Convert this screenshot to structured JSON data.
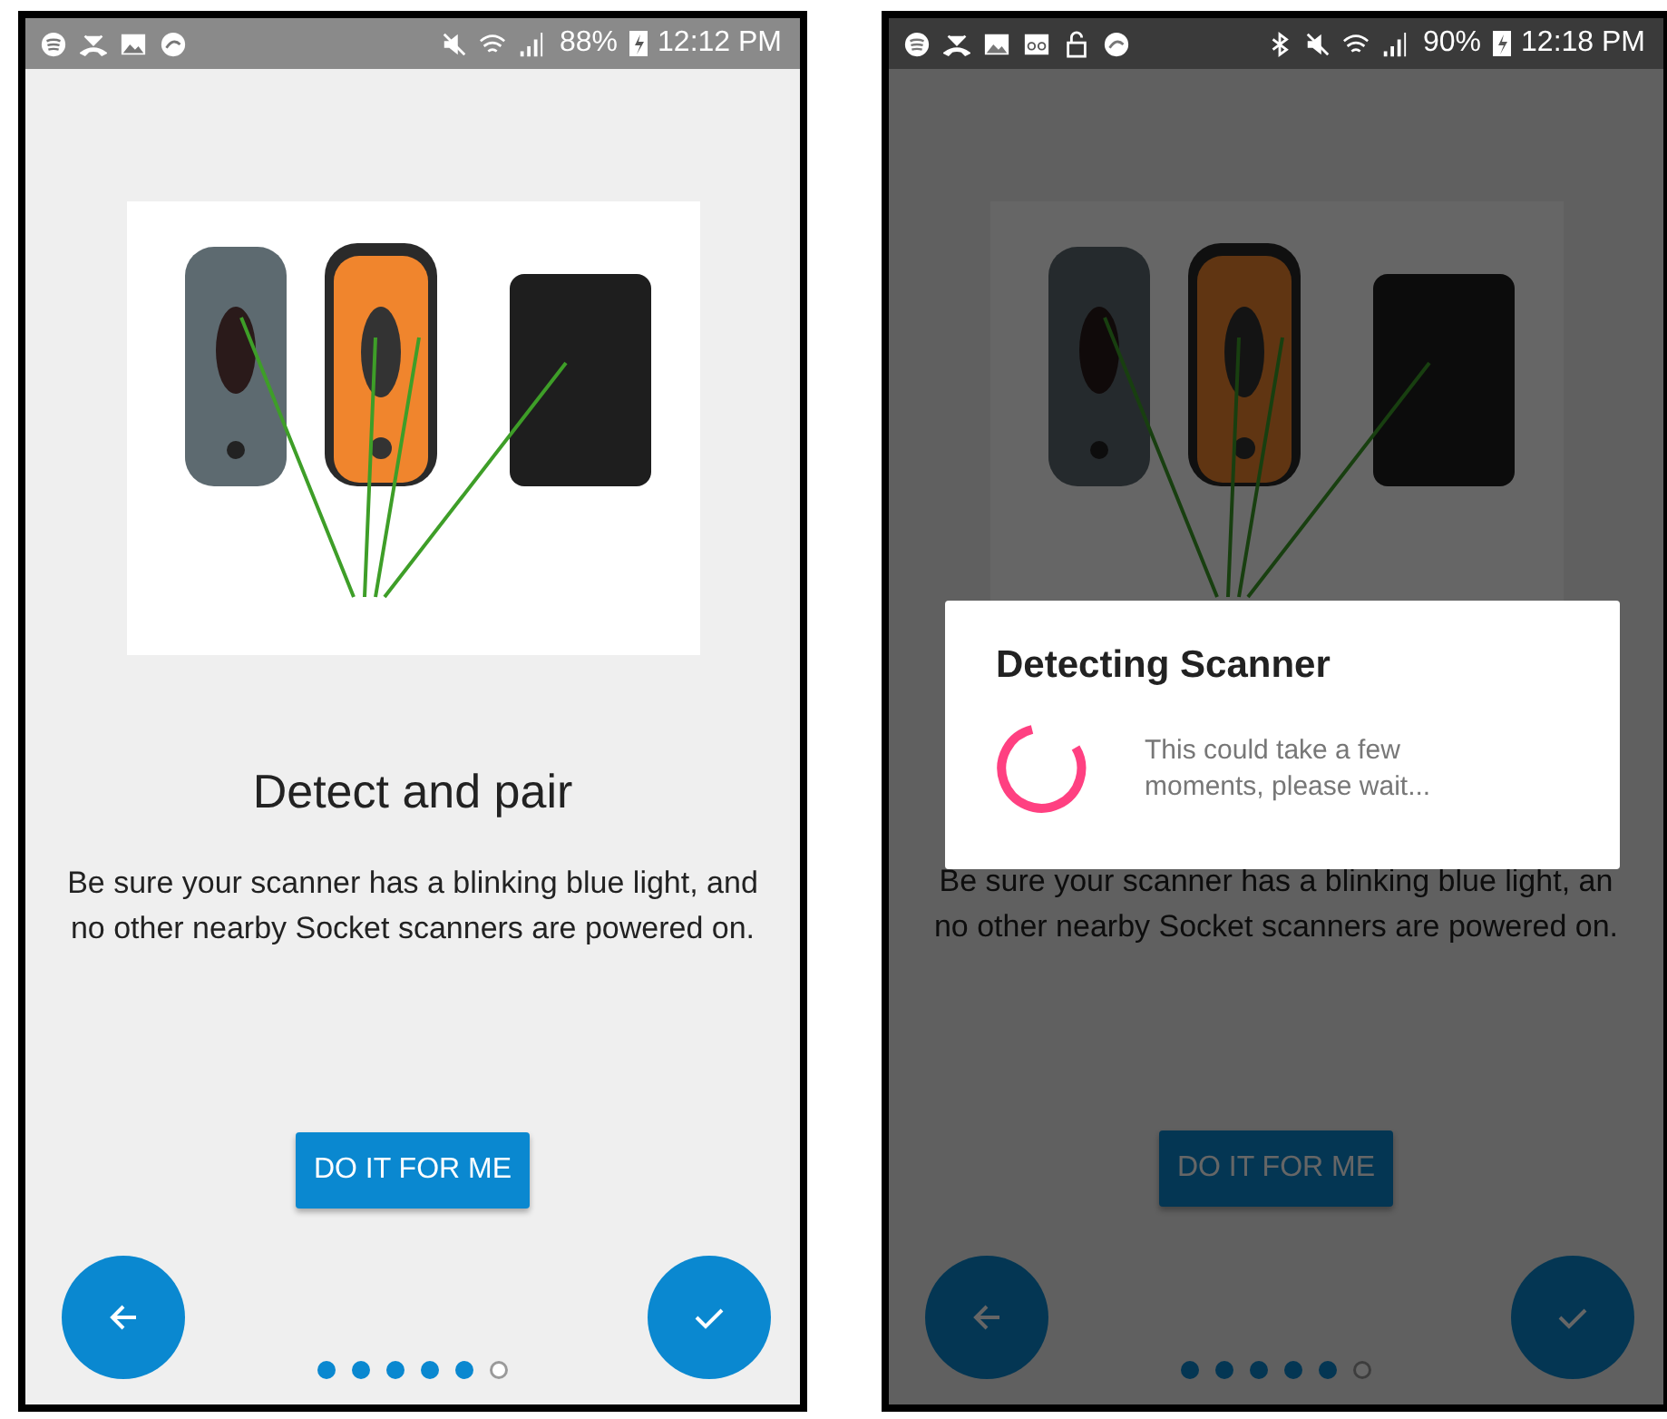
{
  "phones": [
    {
      "status_bar": {
        "voicemail": false,
        "locked": false,
        "bluetooth": false,
        "battery": "88%",
        "time": "12:12 PM",
        "dimmed": false
      },
      "title": "Detect and pair",
      "description": [
        "Be sure your scanner has a blinking blue light, and",
        "no other nearby Socket scanners are powered on."
      ],
      "action_button": "DO IT FOR ME",
      "dots": [
        {
          "selected": false
        },
        {
          "selected": false
        },
        {
          "selected": false
        },
        {
          "selected": false
        },
        {
          "selected": false
        },
        {
          "selected": true
        }
      ]
    },
    {
      "status_bar": {
        "voicemail": true,
        "locked": true,
        "bluetooth": true,
        "battery": "90%",
        "time": "12:18 PM",
        "dimmed": true
      },
      "description": [
        "Be sure your scanner has a blinking blue light, an",
        "no other nearby Socket scanners are powered on."
      ],
      "action_button": "DO IT FOR ME",
      "dots": [
        {
          "selected": false
        },
        {
          "selected": false
        },
        {
          "selected": false
        },
        {
          "selected": false
        },
        {
          "selected": false
        },
        {
          "selected": true
        }
      ],
      "dialog": {
        "title": "Detecting Scanner",
        "message": "This could take a few moments, please wait..."
      }
    }
  ]
}
